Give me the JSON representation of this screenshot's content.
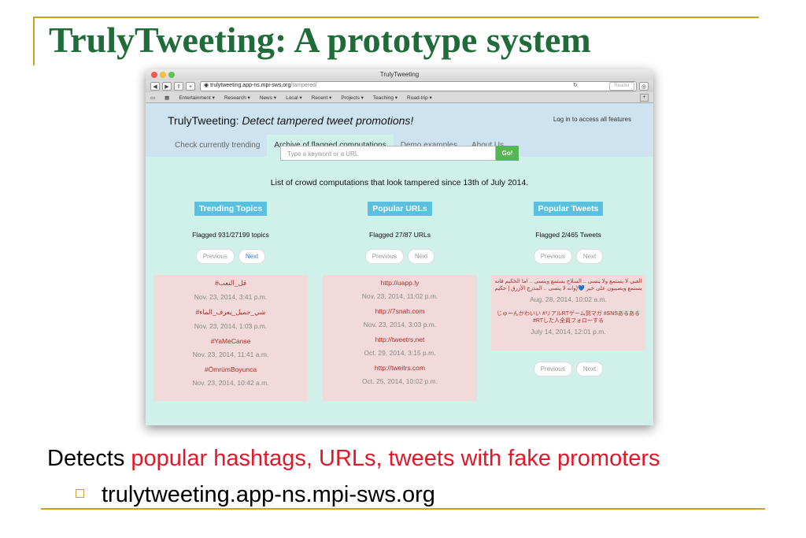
{
  "slide": {
    "title": "TrulyTweeting: A prototype system",
    "caption_prefix": "Detects",
    "caption_highlight": "popular hashtags, URLs, tweets with fake promoters",
    "sub_bullet": "trulytweeting.app-ns.mpi-sws.org"
  },
  "colors": {
    "title": "#1f6b3a",
    "accent_rule": "#c9a227",
    "highlight": "#e0192a",
    "page_bg": "#d0f0ea",
    "header_bg": "#cde4f0",
    "button_blue": "#5bc0de",
    "go_green": "#55b754",
    "panel_pink": "#f2d9da"
  },
  "browser": {
    "window_title": "TrulyTweeting",
    "url_host": "trulytweeting.app-ns.mpi-sws.org",
    "url_path": "/tampered/",
    "reader_label": "Reader",
    "bookmarks": [
      "Entertainment ▾",
      "Research ▾",
      "News ▾",
      "Local ▾",
      "Recent ▾",
      "Projects ▾",
      "Teaching ▾",
      "Road-trip ▾"
    ]
  },
  "site": {
    "brand": "TrulyTweeting:",
    "tagline": "Detect tampered tweet promotions!",
    "login": "Log in to access all features",
    "tabs": [
      "Check currently trending",
      "Archive of flagged computations",
      "Demo examples",
      "About Us"
    ],
    "search_placeholder": "Type a keyword or a URL",
    "go_label": "Go!",
    "headline": "List of crowd computations that look tampered since 13th of July 2014.",
    "prev_label": "Previous",
    "next_label": "Next"
  },
  "columns": [
    {
      "heading": "Trending Topics",
      "flagged": "Flagged 931/27199 topics",
      "items": [
        {
          "title": "#قل_النعب",
          "date": "Nov. 23, 2014, 3:41 p.m."
        },
        {
          "title": "#شي_جميل_يعرف_الماء",
          "date": "Nov. 23, 2014, 1:03 p.m."
        },
        {
          "title": "#YaMeCanse",
          "date": "Nov. 23, 2014, 11:41 a.m."
        },
        {
          "title": "#ÖmrümBoyunca",
          "date": "Nov. 23, 2014, 10:42 a.m."
        }
      ]
    },
    {
      "heading": "Popular URLs",
      "flagged": "Flagged 27/87 URLs",
      "items": [
        {
          "title": "http://uapp.ly",
          "date": "Nov. 23, 2014, 11:02 p.m."
        },
        {
          "title": "http://7snah.com",
          "date": "Nov. 23, 2014, 3:03 p.m."
        },
        {
          "title": "http://tweetrs.net",
          "date": "Oct. 29, 2014, 3:15 p.m."
        },
        {
          "title": "http://tweitrs.com",
          "date": "Oct. 25, 2014, 10:02 p.m."
        }
      ]
    },
    {
      "heading": "Popular Tweets",
      "flagged": "Flagged 2/465 Tweets",
      "items": [
        {
          "title": "الغبي لا يستمع ولا ينسى .. السلاح يستمع وينسى .. اما الحكيم فانه يستمع ويصيبون على خير 💙(وانه لا ينسى .. المدرج الأزرق | حكيم",
          "date": "Aug. 28, 2014, 10:02 a.m."
        },
        {
          "title": "じゅーんかわいい #リアルRTゲーム到マガ #SNSあるある #RTした人全員フォローする",
          "date": "July 14, 2014, 12:01 p.m."
        }
      ]
    }
  ]
}
